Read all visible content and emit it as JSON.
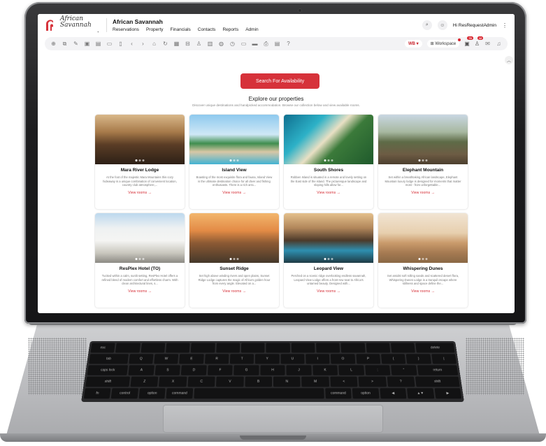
{
  "header": {
    "brand_title": "African Savannah",
    "logo_text": "African Savannah",
    "menu": [
      "Reservations",
      "Property",
      "Financials",
      "Contacts",
      "Reports",
      "Admin"
    ],
    "user_label": "Hi ResRequestAdmin"
  },
  "toolbar": {
    "currency_label": "WB",
    "workspace_label": "Workspace",
    "badges": [
      "78",
      "12"
    ]
  },
  "content": {
    "search_button": "Search For Availability",
    "heading": "Explore our properties",
    "subheading": "Discover unique destinations and handpicked accommodation. Browse our collection below and view available rooms.",
    "link_label": "View rooms →"
  },
  "properties": [
    {
      "name": "Mara River Lodge",
      "desc": "At the foot of the majestic Mara Mountains this cozy hideaway is a unique combination of convenient location, country club atmosphere,..."
    },
    {
      "name": "Island View",
      "desc": "Boasting of the most exquisite flora and fauna, Island View is the ultimate destination choice for all diver and fishing enthusiasts. There is a rich arra..."
    },
    {
      "name": "South Shores",
      "desc": "Robben Island is situated in a remote and lovely setting on the East side of the island. The picturesque landscape and sloping hills allow for..."
    },
    {
      "name": "Elephant Mountain",
      "desc": "Set within a breathtaking African landscape, Elephant Mountain luxury lodge is designed for moments that matter most - from unforgettable..."
    },
    {
      "name": "ResPlex Hotel (TO)",
      "desc": "Tucked within a calm, sunlit setting, ResPlex Hotel offers a refined blend of modern comfort and effortless charm. With clean architectural lines, s..."
    },
    {
      "name": "Sunset Ridge",
      "desc": "Set high above winding rivers and open plains, Sunset Ridge Lodge captures the magic of Africa's golden hour from every angle. Elevated on a..."
    },
    {
      "name": "Leopard View",
      "desc": "Perched on a scenic ridge overlooking endless savannah, Leopard View Lodge offers a front-row seat to Africa's untamed beauty. Designed with..."
    },
    {
      "name": "Whispering Dunes",
      "desc": "Set amidst soft rolling sands and scattered desert flora, Whispering Dunes Lodge is a tranquil escape where stillness and space define the..."
    }
  ],
  "colors": {
    "accent": "#d6323a",
    "toolbar_bg": "#f3f3f5"
  },
  "keyboard": {
    "rows": [
      [
        "esc",
        "",
        "",
        "",
        "",
        "",
        "",
        "",
        "",
        "",
        "",
        "",
        "",
        "delete"
      ],
      [
        "tab",
        "Q",
        "W",
        "E",
        "R",
        "T",
        "Y",
        "U",
        "I",
        "O",
        "P",
        "{",
        "}",
        "|"
      ],
      [
        "caps lock",
        "A",
        "S",
        "D",
        "F",
        "G",
        "H",
        "J",
        "K",
        "L",
        ":",
        "\"",
        "return"
      ],
      [
        "shift",
        "Z",
        "X",
        "C",
        "V",
        "B",
        "N",
        "M",
        "<",
        ">",
        "?",
        "shift"
      ],
      [
        "fn",
        "control",
        "option",
        "command",
        "",
        "command",
        "option",
        "◀",
        "▲▼",
        "▶"
      ]
    ]
  }
}
